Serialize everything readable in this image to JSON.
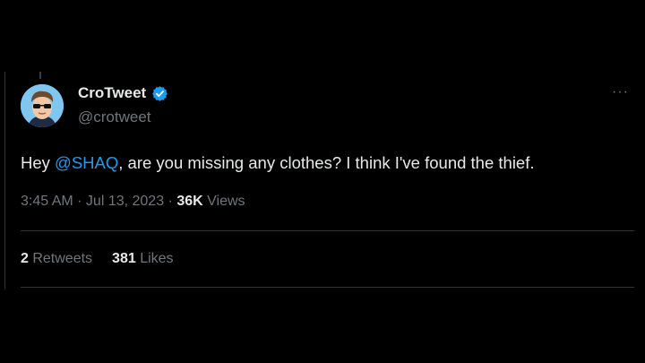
{
  "tweet": {
    "author": {
      "display_name": "CroTweet",
      "handle": "@crotweet",
      "verified_icon": "verified-badge-icon",
      "badge_color": "#1d9bf0"
    },
    "text": {
      "before": "Hey ",
      "mention": "@SHAQ",
      "after": ", are you missing any clothes? I think I've found the thief."
    },
    "meta": {
      "time": "3:45 AM",
      "sep1": " · ",
      "date": "Jul 13, 2023",
      "sep2": " · ",
      "views_count": "36K",
      "views_label": " Views"
    },
    "stats": {
      "retweets_count": "2",
      "retweets_label": " Retweets",
      "likes_count": "381",
      "likes_label": " Likes"
    },
    "more_icon": "more-horizontal-icon",
    "more_label": "···",
    "colors": {
      "background": "#000000",
      "text": "#e7e9ea",
      "secondary": "#71767b",
      "accent": "#1d9bf0",
      "divider": "#2f3336"
    }
  }
}
